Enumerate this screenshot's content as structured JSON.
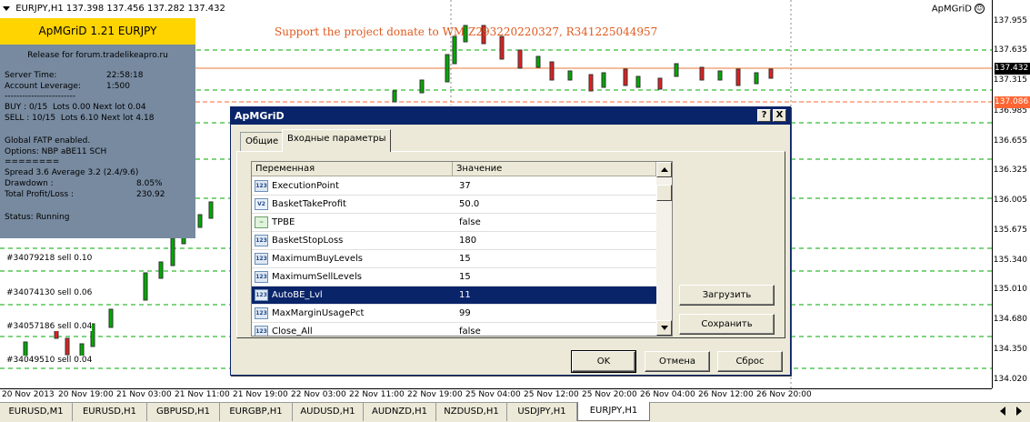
{
  "chart": {
    "symbol_label": "EURJPY,H1",
    "ohlc": "137.398 137.456 137.282 137.432",
    "ea_name": "ApMGriD",
    "donate_text": "Support the project donate to WM Z293220220327, R341225044957",
    "price_axis": [
      "137.955",
      "137.635",
      "137.315",
      "136.985",
      "136.655",
      "136.325",
      "136.005",
      "135.675",
      "135.340",
      "135.010",
      "134.680",
      "134.350",
      "134.020"
    ],
    "bid_box": "137.432",
    "level_box": "137.086",
    "bid_color": "#000000",
    "level_color": "#ff6633",
    "time_axis": [
      "20 Nov 2013",
      "20 Nov 19:00",
      "21 Nov 03:00",
      "21 Nov 11:00",
      "21 Nov 19:00",
      "22 Nov 03:00",
      "22 Nov 11:00",
      "22 Nov 19:00",
      "25 Nov 04:00",
      "25 Nov 12:00",
      "25 Nov 20:00",
      "26 Nov 04:00",
      "26 Nov 12:00",
      "26 Nov 20:00"
    ],
    "order_labels": [
      "#34079218 sell 0.10",
      "#34074130 sell 0.06",
      "#34057186 sell 0.04",
      "#34049510 sell 0.04"
    ]
  },
  "ea_panel": {
    "title": "ApMGriD 1.21 EURJPY",
    "release": "Release for forum.tradelikeapro.ru",
    "server_time_label": "Server Time:",
    "server_time": "22:58:18",
    "leverage_label": "Account Leverage:",
    "leverage": "1:500",
    "separator1": "------------------------",
    "buy_line": "BUY : 0/15  Lots 0.00 Next lot 0.04",
    "sell_line": "SELL : 10/15  Lots 6.10 Next lot 4.18",
    "fatp": "Global FATP enabled.",
    "options": "Options: NBP aBE11 SCH",
    "separator2": "========",
    "spread": "Spread 3.6 Average 3.2 (2.4/9.6)",
    "drawdown_label": "Drawdown :",
    "drawdown": "8.05%",
    "profit_label": "Total Profit/Loss :",
    "profit": "230.92",
    "status": "Status: Running"
  },
  "dialog": {
    "title": "ApMGriD",
    "help_btn": "?",
    "close_btn": "X",
    "tabs": [
      "Общие",
      "Входные параметры"
    ],
    "columns": [
      "Переменная",
      "Значение"
    ],
    "rows": [
      {
        "name": "ExecutionPoint",
        "value": "37",
        "type": "123"
      },
      {
        "name": "BasketTakeProfit",
        "value": "50.0",
        "type": "V2"
      },
      {
        "name": "TPBE",
        "value": "false",
        "type": "bool"
      },
      {
        "name": "BasketStopLoss",
        "value": "180",
        "type": "123"
      },
      {
        "name": "MaximumBuyLevels",
        "value": "15",
        "type": "123"
      },
      {
        "name": "MaximumSellLevels",
        "value": "15",
        "type": "123"
      },
      {
        "name": "AutoBE_Lvl",
        "value": "11",
        "type": "123"
      },
      {
        "name": "MaxMarginUsagePct",
        "value": "99",
        "type": "123"
      },
      {
        "name": "Close_All",
        "value": "false",
        "type": "123"
      }
    ],
    "load_btn": "Загрузить",
    "save_btn": "Сохранить",
    "ok_btn": "OK",
    "cancel_btn": "Отмена",
    "reset_btn": "Сброс"
  },
  "symbol_tabs": [
    "EURUSD,M1",
    "EURUSD,H1",
    "GBPUSD,H1",
    "EURGBP,H1",
    "AUDUSD,H1",
    "AUDNZD,H1",
    "NZDUSD,H1",
    "USDJPY,H1",
    "EURJPY,H1"
  ],
  "active_tab": "EURJPY,H1"
}
